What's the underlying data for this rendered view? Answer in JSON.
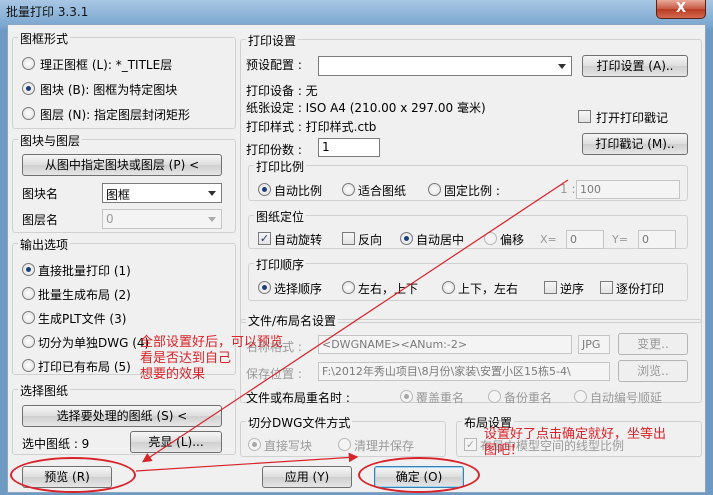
{
  "window": {
    "title": "批量打印 3.3.1",
    "close_label": "X"
  },
  "frame_type": {
    "group_title": "图框形式",
    "options": [
      {
        "label": "理正图框 (L): *_TITLE层",
        "selected": false
      },
      {
        "label": "图块 (B): 图框为特定图块",
        "selected": true
      },
      {
        "label": "图层 (N): 指定图层封闭矩形",
        "selected": false
      }
    ]
  },
  "block_layer": {
    "group_title": "图块与图层",
    "pick_button": "从图中指定图块或图层 (P) <",
    "block_label": "图块名",
    "block_value": "图框",
    "layer_label": "图层名",
    "layer_value": "0"
  },
  "output": {
    "group_title": "输出选项",
    "options": [
      {
        "label": "直接批量打印 (1)",
        "selected": true
      },
      {
        "label": "批量生成布局 (2)",
        "selected": false
      },
      {
        "label": "生成PLT文件 (3)",
        "selected": false
      },
      {
        "label": "切分为单独DWG (4)",
        "selected": false
      },
      {
        "label": "打印已有布局 (5)",
        "selected": false
      }
    ]
  },
  "select_drawing": {
    "group_title": "选择图纸",
    "select_button": "选择要处理的图纸 (S) <",
    "selected_label": "选中图纸 : 9",
    "highlight_button": "亮显 (L)..."
  },
  "print_settings": {
    "group_title": "打印设置",
    "preset_label": "预设配置 :",
    "preset_value": "",
    "settings_button": "打印设置 (A)..",
    "device": "打印设备 : 无",
    "paper": "纸张设定 : ISO A4 (210.00 x 297.00 毫米)",
    "style": "打印样式 : 打印样式.ctb",
    "stamp_check_label": "打开打印戳记",
    "stamp_check": false,
    "stamp_button": "打印戳记 (M)..",
    "copies_label": "打印份数 :",
    "copies_value": "1"
  },
  "scale": {
    "group_title": "打印比例",
    "options": [
      {
        "label": "自动比例",
        "selected": true
      },
      {
        "label": "适合图纸",
        "selected": false
      },
      {
        "label": "固定比例 :",
        "selected": false
      }
    ],
    "ratio_prefix": "1 :",
    "ratio_value": "100"
  },
  "position": {
    "group_title": "图纸定位",
    "auto_rotate": {
      "label": "自动旋转",
      "checked": true
    },
    "reverse": {
      "label": "反向",
      "checked": false
    },
    "auto_center": {
      "label": "自动居中",
      "selected": true
    },
    "offset": {
      "label": "偏移",
      "selected": false
    },
    "x_label": "X=",
    "x_value": "0",
    "y_label": "Y=",
    "y_value": "0"
  },
  "order": {
    "group_title": "打印顺序",
    "options": [
      {
        "label": "选择顺序",
        "selected": true
      },
      {
        "label": "左右，上下",
        "selected": false
      },
      {
        "label": "上下，左右",
        "selected": false
      }
    ],
    "reverse": {
      "label": "逆序",
      "checked": false
    },
    "one_by_one": {
      "label": "逐份打印",
      "checked": false
    }
  },
  "file_naming": {
    "group_title": "文件/布局名设置",
    "name_label": "名称格式 :",
    "name_value": "<DWGNAME><ANum:-2>",
    "ext_value": "JPG",
    "change_button": "变更..",
    "save_label": "保存位置 :",
    "save_value": "F:\\2012年秀山项目\\8月份\\家装\\安置小区15栋5-4\\",
    "browse_button": "浏览..",
    "rename_label": "文件或布局重名时 :",
    "rename_options": [
      {
        "label": "覆盖重名",
        "selected": true
      },
      {
        "label": "备份重名",
        "selected": false
      },
      {
        "label": "自动编号顺延",
        "selected": false
      }
    ]
  },
  "split_dwg": {
    "group_title": "切分DWG文件方式",
    "options": [
      {
        "label": "直接写块",
        "selected": true
      },
      {
        "label": "清理并保存",
        "selected": false
      }
    ]
  },
  "layout": {
    "group_title": "布局设置",
    "check_label": "布局中模型空间的线型比例",
    "checked": true
  },
  "buttons": {
    "preview": "预览 (R)",
    "apply": "应用 (Y)",
    "ok": "确定 (O)"
  },
  "annotations": {
    "left_note": [
      "全部设置好后，可以预览",
      "看是否达到自己",
      "想要的效果"
    ],
    "right_note": [
      "设置好了点击确定就好，坐等出",
      "图吧！"
    ]
  },
  "colors": {
    "annotation": "#d8232a",
    "title_bar": "#7aa6cf"
  }
}
